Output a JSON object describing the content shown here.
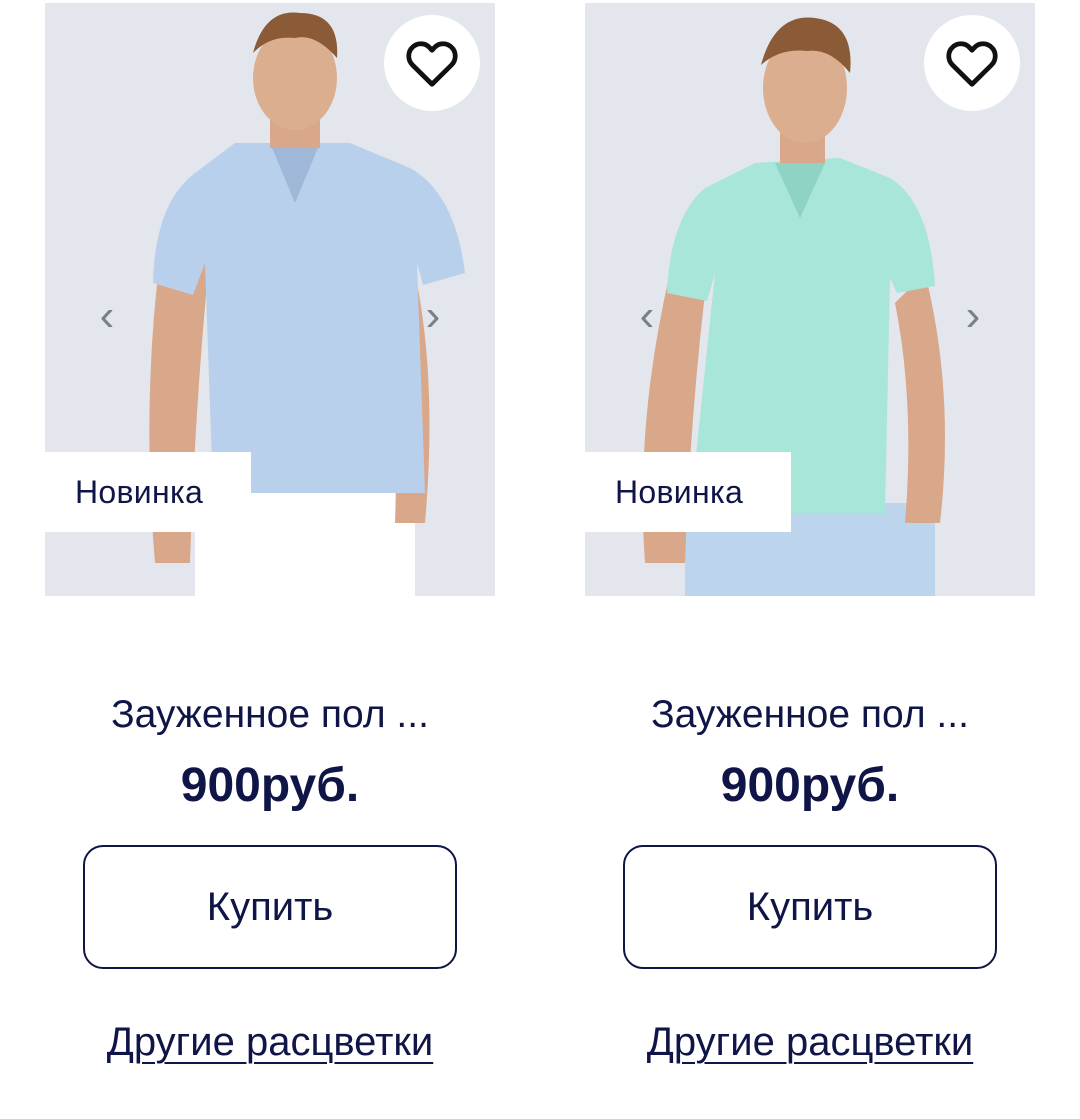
{
  "products": [
    {
      "badge": "Новинка",
      "name": "Зауженное пол ...",
      "price": "900руб.",
      "buy_label": "Купить",
      "other_colors_label": "Другие расцветки",
      "shirt_color": "#b9d0ec",
      "trousers_color": "#ffffff"
    },
    {
      "badge": "Новинка",
      "name": "Зауженное пол ...",
      "price": "900руб.",
      "buy_label": "Купить",
      "other_colors_label": "Другие расцветки",
      "shirt_color": "#a7e6d8",
      "trousers_color": "#bcd5ec"
    }
  ],
  "icons": {
    "favorite": "heart-outline-icon",
    "prev": "chevron-left-icon",
    "next": "chevron-right-icon"
  },
  "theme": {
    "text_color": "#0f1547",
    "photo_background": "#e3e6ec"
  }
}
